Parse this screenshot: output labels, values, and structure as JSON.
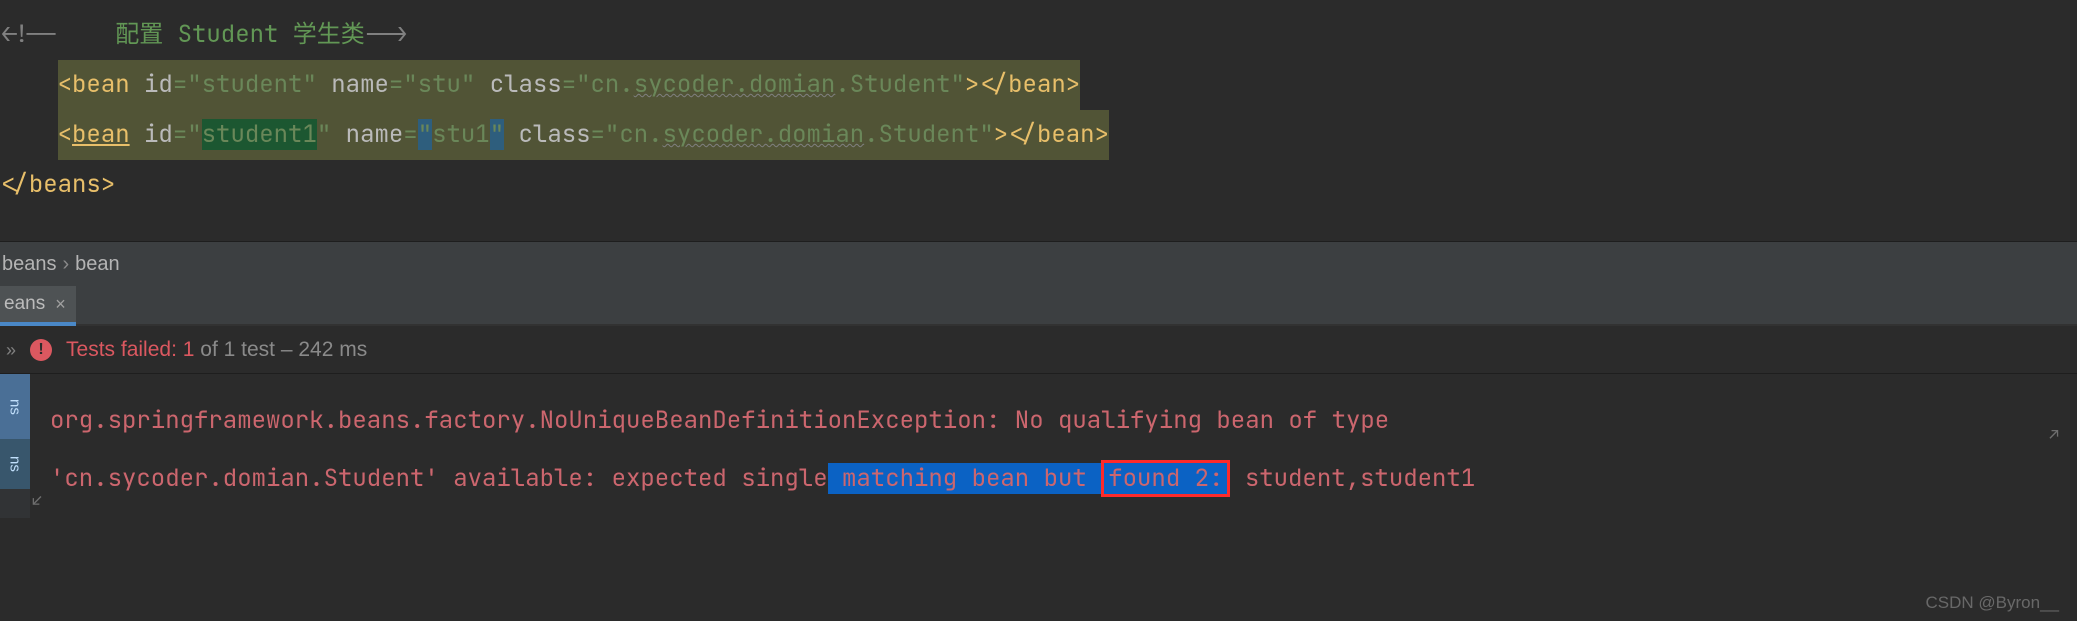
{
  "code": {
    "comment_open": "<!--    ",
    "comment_cjk": "配置 Student 学生类",
    "comment_close": "-->",
    "bean1": {
      "tag": "bean",
      "id_attr": "id",
      "id_val": "\"student\"",
      "name_attr": "name",
      "name_val": "\"stu\"",
      "class_attr": "class",
      "class_eq_q": "=\"",
      "class_pkg": "cn.",
      "class_wave": "sycoder.domian",
      "class_tail": ".Student\"",
      "close": "</",
      "close_tag": "bean",
      "gt": ">"
    },
    "bean2": {
      "tag_open": "<",
      "tag": "bean",
      "id_attr": "id",
      "id_q": "=\"",
      "id_val": "student1",
      "id_qc": "\"",
      "name_attr": "name",
      "name_eq": "=",
      "q1": "\"",
      "name_val": "stu1",
      "q2": "\"",
      "class_attr": "class",
      "class_eq_q": "=\"",
      "class_pkg": "cn.",
      "class_wave": "sycoder.domian",
      "class_tail": ".Student\"",
      "close": "</",
      "close_tag": "bean",
      "gt": ">"
    },
    "end_open": "</",
    "end_tag": "beans",
    "end_gt": ">"
  },
  "breadcrumb": {
    "p1": "beans",
    "p2": "bean"
  },
  "tab": {
    "label": "eans",
    "close": "×"
  },
  "result": {
    "chev": "»",
    "fail_glyph": "!",
    "label": "Tests failed:",
    "count": "1",
    "mid": "of 1 test –",
    "time": "242 ms"
  },
  "gutter": {
    "a": "ns",
    "b": "ns"
  },
  "console": {
    "l1": "org.springframework.beans.factory.NoUniqueBeanDefinitionException: No qualifying bean of type ",
    "l2a": "'cn.sycoder.domian.Student' available: expected single",
    "l2b": " matching bean but ",
    "l2c": "found 2:",
    "l2d": " student,student1",
    "wrap_glyph": "↙",
    "soft_glyph": "↗"
  },
  "watermark": "CSDN @Byron__"
}
